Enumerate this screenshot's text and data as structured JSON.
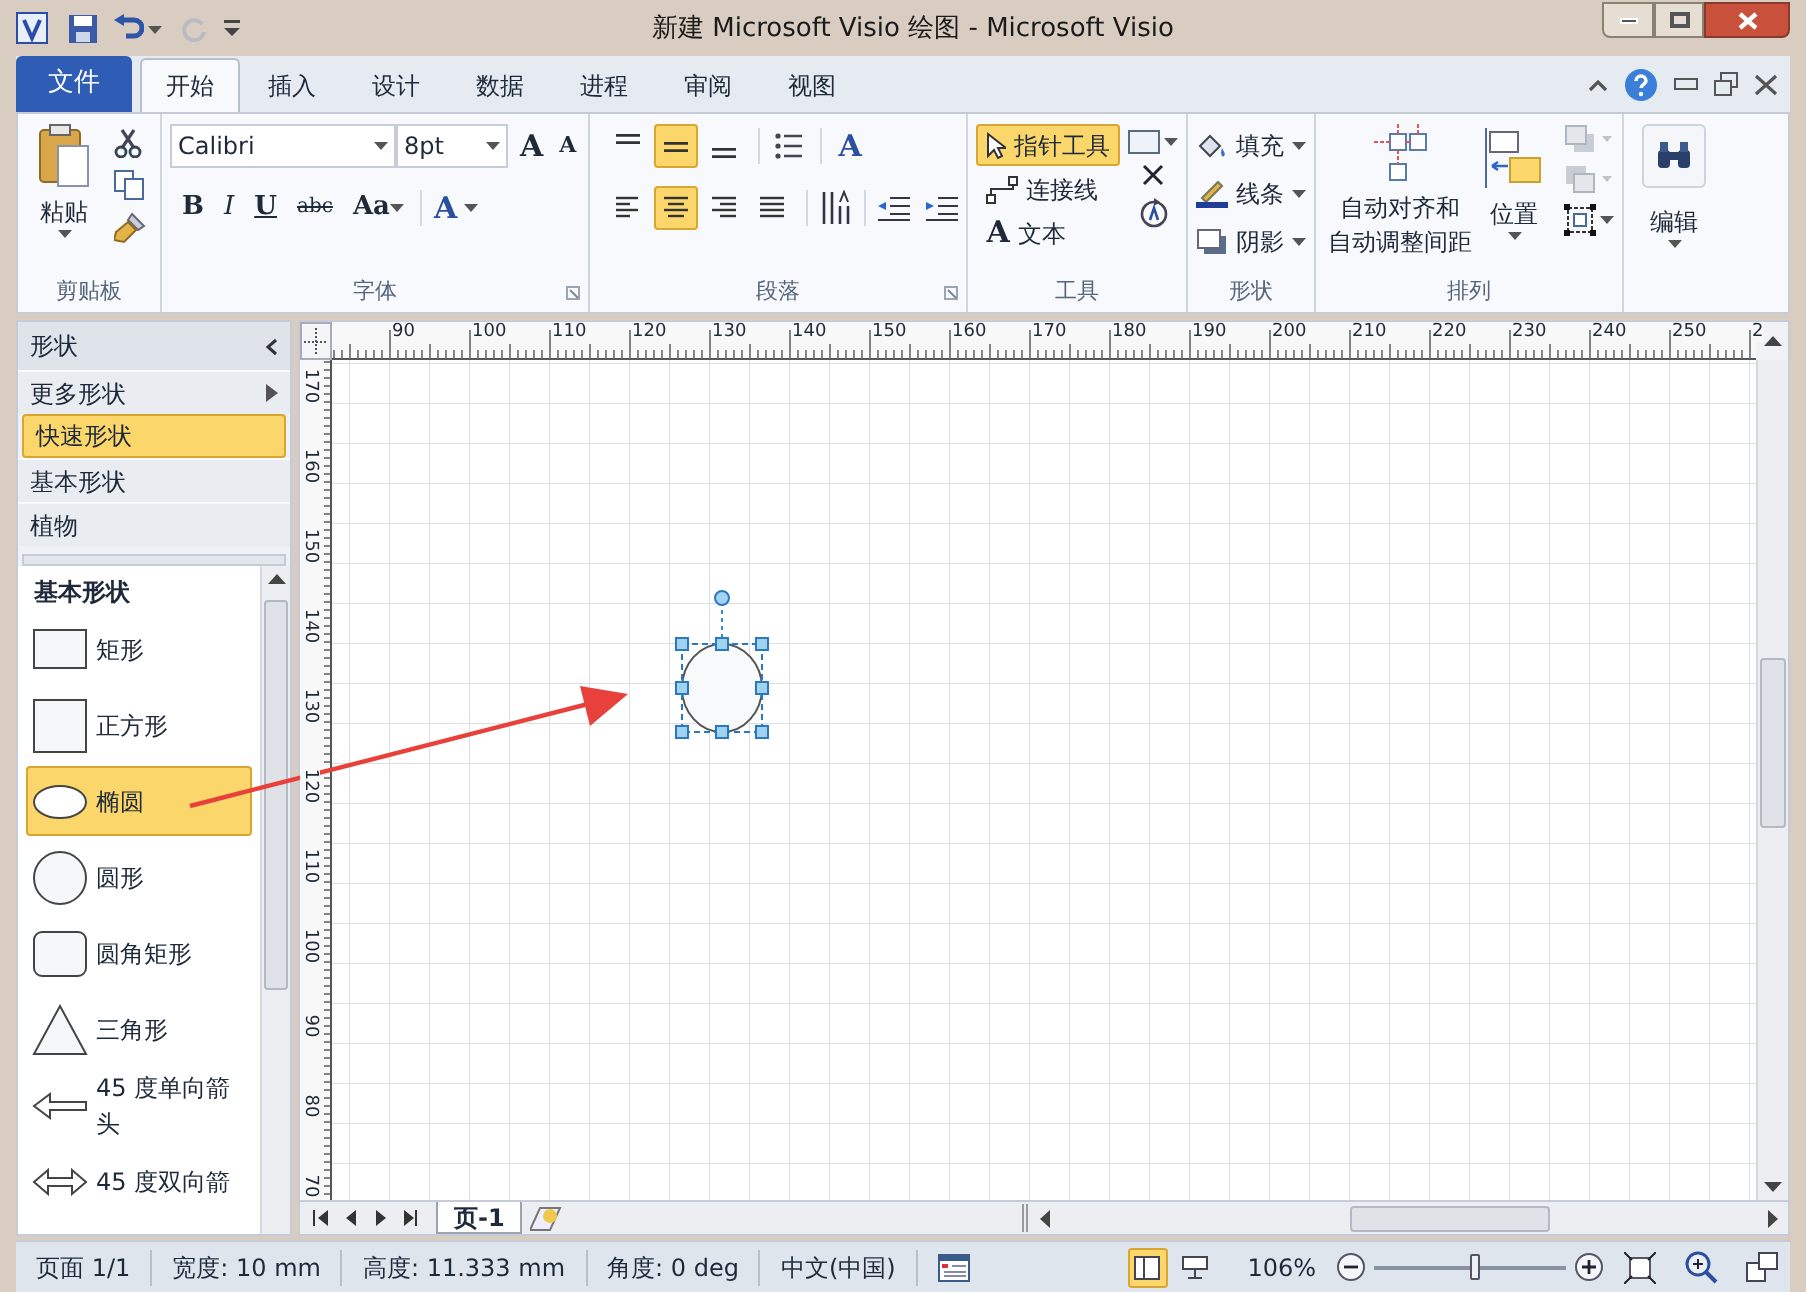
{
  "window": {
    "title": "新建 Microsoft Visio 绘图 - Microsoft Visio"
  },
  "ribbon_tabs": [
    {
      "label": "文件",
      "kind": "file",
      "selected": false
    },
    {
      "label": "开始",
      "kind": "tab",
      "selected": true
    },
    {
      "label": "插入",
      "kind": "tab",
      "selected": false
    },
    {
      "label": "设计",
      "kind": "tab",
      "selected": false
    },
    {
      "label": "数据",
      "kind": "tab",
      "selected": false
    },
    {
      "label": "进程",
      "kind": "tab",
      "selected": false
    },
    {
      "label": "审阅",
      "kind": "tab",
      "selected": false
    },
    {
      "label": "视图",
      "kind": "tab",
      "selected": false
    }
  ],
  "clipboard": {
    "paste_label": "粘贴",
    "group_label": "剪贴板"
  },
  "font": {
    "font_name": "Calibri",
    "font_size": "8pt",
    "grow_button": "A",
    "shrink_button": "A",
    "format_buttons": [
      {
        "label": "B",
        "kind": "bold"
      },
      {
        "label": "I",
        "kind": "italic"
      },
      {
        "label": "U",
        "kind": "underline"
      },
      {
        "label": "abc",
        "kind": "strike"
      },
      {
        "label": "Aa",
        "kind": "case"
      }
    ],
    "color_button": "A",
    "group_label": "字体"
  },
  "paragraph": {
    "vertical_align": [
      {
        "selected": false
      },
      {
        "selected": true
      },
      {
        "selected": false
      }
    ],
    "horizontal_align": [
      {
        "selected": false
      },
      {
        "selected": true
      },
      {
        "selected": false
      },
      {
        "selected": false
      }
    ],
    "text_style_button": "A",
    "group_label": "段落"
  },
  "tools": {
    "items": [
      {
        "label": "指针工具",
        "kind": "pointer",
        "selected": true
      },
      {
        "label": "连接线",
        "kind": "connector",
        "selected": false
      },
      {
        "label": "文本",
        "kind": "text",
        "glyph": "A",
        "selected": false
      }
    ],
    "group_label": "工具"
  },
  "shape_group": {
    "items": [
      {
        "label": "填充",
        "kind": "fill"
      },
      {
        "label": "线条",
        "kind": "line"
      },
      {
        "label": "阴影",
        "kind": "shadow"
      }
    ],
    "group_label": "形状"
  },
  "arrange": {
    "auto_align_lines": [
      "自动对齐和",
      "自动调整间距"
    ],
    "position_label": "位置",
    "group_label": "排列"
  },
  "editing": {
    "label": "编辑"
  },
  "shapes_panel": {
    "title": "形状",
    "nav_items": [
      {
        "label": "更多形状",
        "kind": "more",
        "selected": false
      },
      {
        "label": "快速形状",
        "kind": "stencil",
        "selected": true
      },
      {
        "label": "基本形状",
        "kind": "stencil",
        "selected": false
      },
      {
        "label": "植物",
        "kind": "stencil",
        "selected": false
      }
    ],
    "stencil_title": "基本形状",
    "shapes": [
      {
        "label": "矩形",
        "kind": "rectangle",
        "selected": false
      },
      {
        "label": "正方形",
        "kind": "square",
        "selected": false
      },
      {
        "label": "椭圆",
        "kind": "ellipse",
        "selected": true
      },
      {
        "label": "圆形",
        "kind": "circle",
        "selected": false
      },
      {
        "label": "圆角矩形",
        "kind": "rounded",
        "selected": false
      },
      {
        "label": "三角形",
        "kind": "triangle",
        "selected": false
      },
      {
        "label": "45 度单向箭头",
        "kind": "arrow",
        "selected": false
      },
      {
        "label": "45 度双向箭",
        "kind": "double_arrow",
        "selected": false
      }
    ]
  },
  "rulers": {
    "horizontal": [
      "90",
      "100",
      "110",
      "120",
      "130",
      "140",
      "150",
      "160",
      "170",
      "180",
      "190",
      "200",
      "210",
      "220",
      "230",
      "240",
      "250",
      "2"
    ],
    "vertical": [
      "170",
      "160",
      "150",
      "140",
      "130",
      "120",
      "110",
      "100",
      "90",
      "80",
      "70"
    ]
  },
  "page_tabs": [
    {
      "label": "页-1",
      "selected": true
    }
  ],
  "status_bar": {
    "items": [
      "页面 1/1",
      "宽度: 10 mm",
      "高度: 11.333 mm",
      "角度: 0 deg",
      "中文(中国)"
    ],
    "view_buttons": [
      {
        "kind": "normal",
        "selected": true
      },
      {
        "kind": "presentation",
        "selected": false
      }
    ],
    "zoom": "106%",
    "zoom_slider": {
      "level": 0.53
    }
  }
}
